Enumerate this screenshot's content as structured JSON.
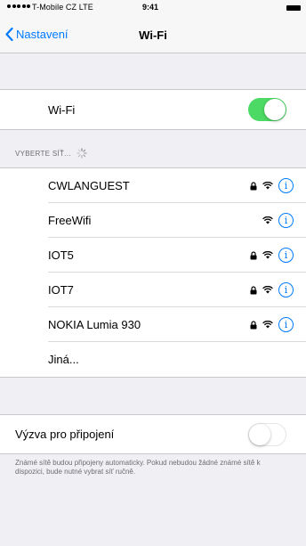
{
  "status_bar": {
    "carrier": "T-Mobile CZ  LTE",
    "time": "9:41"
  },
  "nav": {
    "back_label": "Nastavení",
    "title": "Wi-Fi"
  },
  "wifi_toggle": {
    "label": "Wi-Fi",
    "state": "on"
  },
  "networks_header": "VYBERTE SÍŤ...",
  "networks": [
    {
      "name": "CWLANGUEST",
      "locked": true
    },
    {
      "name": "FreeWifi",
      "locked": false
    },
    {
      "name": "IOT5",
      "locked": true
    },
    {
      "name": "IOT7",
      "locked": true
    },
    {
      "name": "NOKIA Lumia 930",
      "locked": true
    }
  ],
  "other_label": "Jiná...",
  "ask_to_join": {
    "label": "Výzva pro připojení",
    "state": "off"
  },
  "footer_note": "Známé sítě budou připojeny automaticky. Pokud nebudou žádné známé sítě k dispozici, bude nutné vybrat síť ručně.",
  "colors": {
    "accent": "#007aff",
    "toggle_on": "#4cd964",
    "brand": "#e20074",
    "background": "#efeff4"
  }
}
